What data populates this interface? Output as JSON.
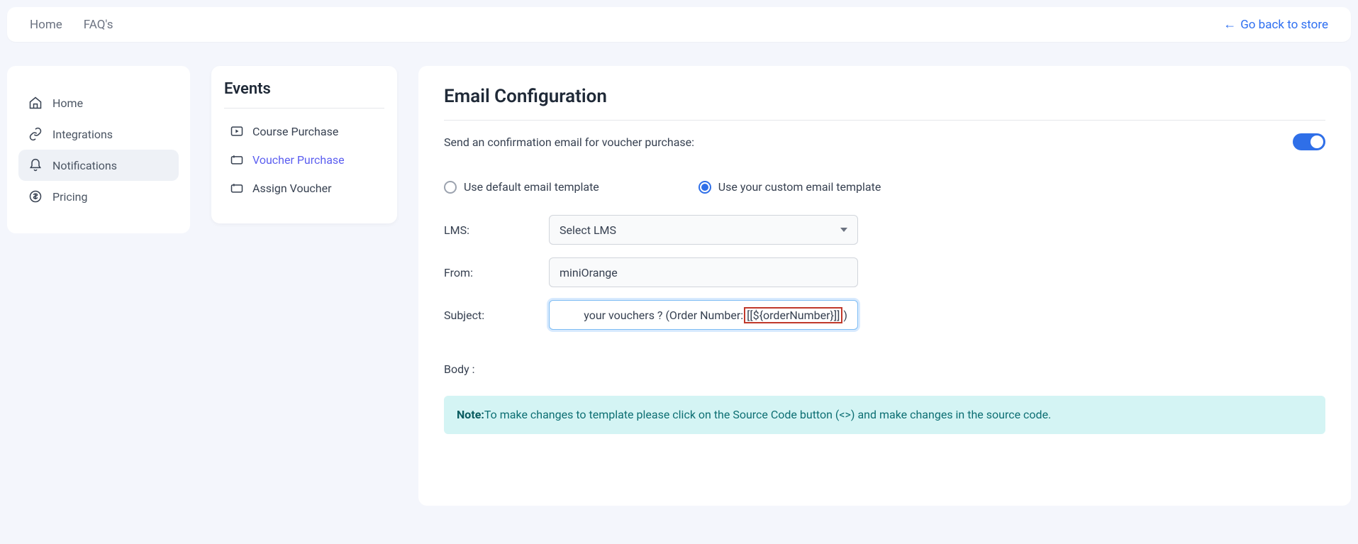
{
  "topbar": {
    "home": "Home",
    "faqs": "FAQ's",
    "back": "Go back to store"
  },
  "sidebar": {
    "items": [
      {
        "label": "Home"
      },
      {
        "label": "Integrations"
      },
      {
        "label": "Notifications"
      },
      {
        "label": "Pricing"
      }
    ]
  },
  "events": {
    "title": "Events",
    "items": [
      {
        "label": "Course Purchase"
      },
      {
        "label": "Voucher Purchase"
      },
      {
        "label": "Assign Voucher"
      }
    ]
  },
  "main": {
    "title": "Email Configuration",
    "confirm_label": "Send an confirmation email for voucher purchase:",
    "radio_default": "Use default email template",
    "radio_custom": "Use your custom email template",
    "lms_label": "LMS:",
    "lms_value": "Select LMS",
    "from_label": "From:",
    "from_value": "miniOrange",
    "subject_label": "Subject:",
    "subject_prefix": "your vouchers ? (Order Number:",
    "subject_token": "[[${orderNumber}]]",
    "subject_suffix": ")",
    "body_label": "Body :",
    "note_prefix": "Note:",
    "note_text": "To make changes to template please click on the Source Code button (<>) and make changes in the source code."
  }
}
